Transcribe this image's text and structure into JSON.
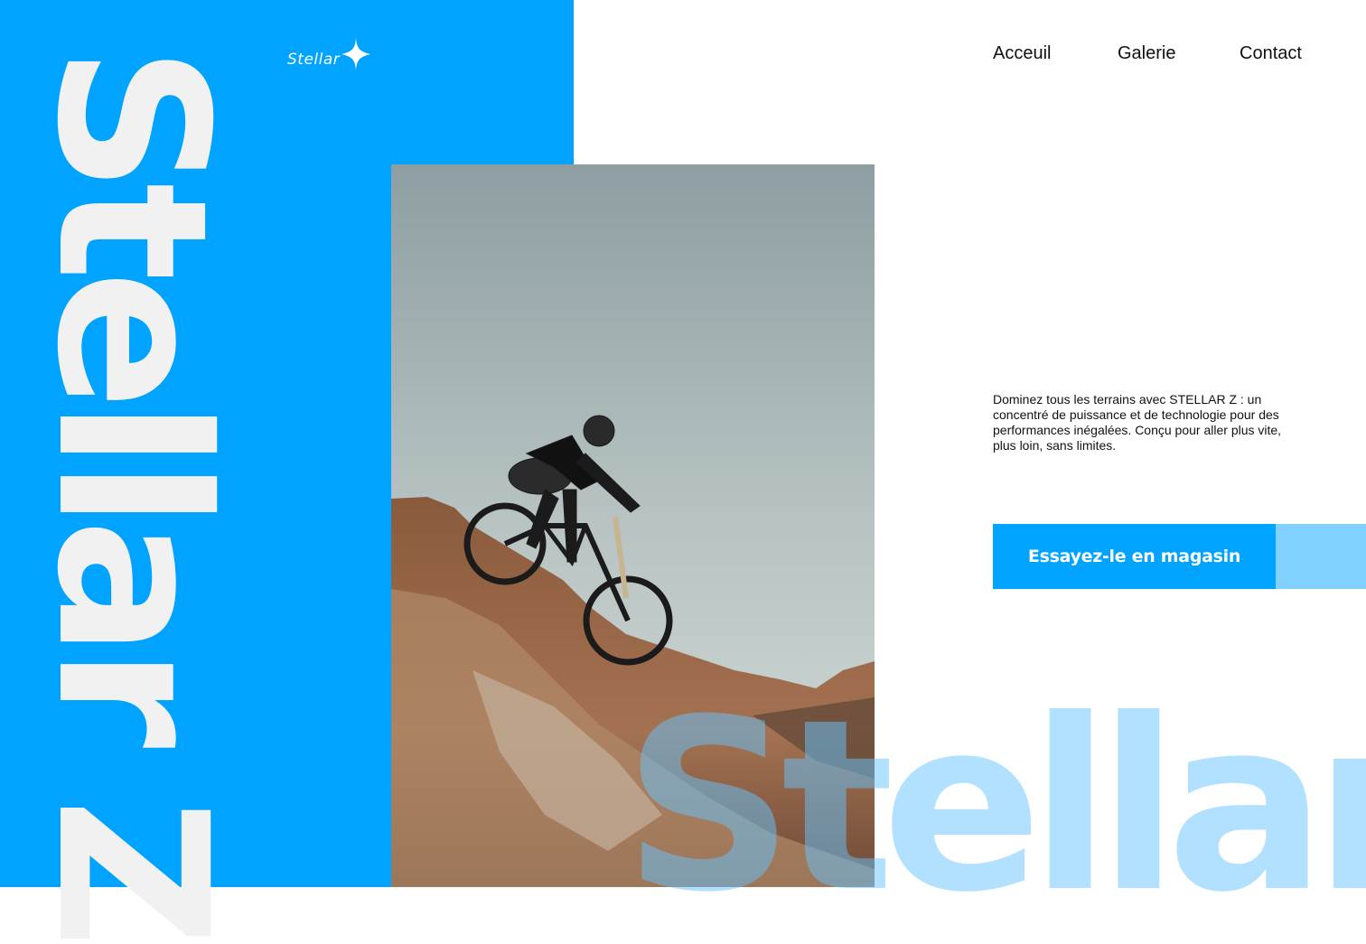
{
  "brand": {
    "logo_text": "Stellar",
    "hero_title": "Stellar Z",
    "watermark": "Stellar"
  },
  "nav": {
    "items": [
      {
        "label": "Acceuil"
      },
      {
        "label": "Galerie"
      },
      {
        "label": "Contact"
      }
    ]
  },
  "main": {
    "description": "Dominez tous les terrains avec STELLAR Z : un concentré de puissance et de technologie pour des performances inégalées. Conçu pour aller plus vite, plus loin, sans limites.",
    "cta_label": "Essayez-le en magasin"
  },
  "colors": {
    "primary": "#00a3ff",
    "accent_light": "#80d1ff",
    "title_text": "#f1f1f1"
  },
  "icons": {
    "logo": "star-sparkle-icon"
  }
}
